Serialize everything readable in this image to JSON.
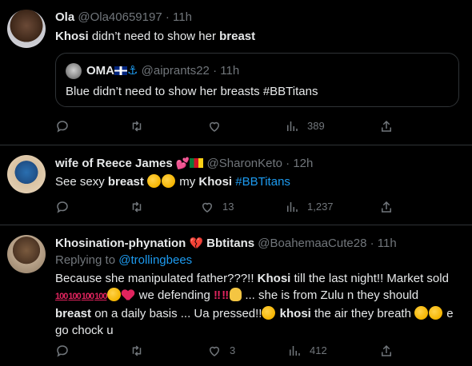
{
  "tweets": [
    {
      "name": "Ola",
      "handle": "@Ola40659197",
      "sep": "·",
      "time": "11h",
      "text_pre": "Khosi",
      "text_mid": " didn’t need to show her ",
      "text_bold": "breast",
      "quote": {
        "name": "OMA",
        "handle": "@aiprants22",
        "time": "11h",
        "text": "Blue didn’t need to show her breasts  #BBTitans"
      },
      "retweets": "",
      "likes": "",
      "views": "389"
    },
    {
      "name": "wife of Reece James",
      "handle": "@SharonKeto",
      "sep": "·",
      "time": "12h",
      "text_1": "See sexy ",
      "text_bold1": "breast",
      "text_2": " my ",
      "text_bold2": "Khosi",
      "text_hashtag": "#BBTitans",
      "retweets": "",
      "likes": "13",
      "views": "1,237"
    },
    {
      "name": "Khosination-phynation",
      "name_suffix": "Bbtitans",
      "handle": "@BoahemaaCute28",
      "sep": "·",
      "time": "11h",
      "replying_label": "Replying to ",
      "replying_handle": "@trollingbees",
      "line1_a": "Because she manipulated father???!! ",
      "line1_b": "Khosi",
      "line1_c": " till the last night!! Market sold",
      "hundred": "100",
      "line2_a": " we defending ",
      "bang": "‼",
      "line2_b": "... she is from Zulu n they should",
      "line3_a": "breast",
      "line3_b": " on a daily basis ... Ua pressed!!",
      "line3_c": "khosi",
      "line3_d": " the air they breath ",
      "line3_e": " e",
      "line4": "go chock u",
      "retweets": "",
      "likes": "3",
      "views": "412"
    }
  ],
  "icons": [
    "reply-icon",
    "retweet-icon",
    "like-icon",
    "views-icon",
    "share-icon"
  ],
  "colors": {
    "background": "#000000",
    "text": "#e7e9ea",
    "muted": "#71767b",
    "link": "#1d9bf0",
    "border": "#2f3336"
  }
}
